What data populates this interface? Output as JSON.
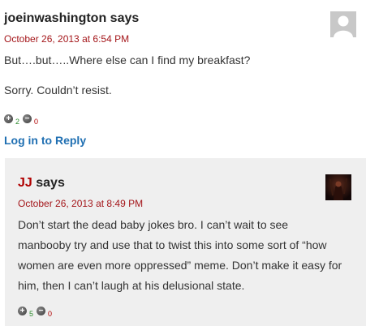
{
  "comment1": {
    "author": "joeinwashington",
    "says": "says",
    "date": "October 26, 2013 at 6:54 PM",
    "paragraphs": [
      "But….but…..Where else can I find my breakfast?",
      "Sorry. Couldn’t resist."
    ],
    "votes_up": "2",
    "votes_down": "0",
    "reply_link": "Log in to Reply"
  },
  "comment2": {
    "author": "JJ",
    "says": "says",
    "date": "October 26, 2013 at 8:49 PM",
    "lines": [
      "Don’t start the dead baby jokes bro. I can’t wait to see",
      "manbooby try and use that to twist this into some sort of “how",
      "women are even more oppressed” meme. Don’t make it easy for",
      "him, then I can’t laugh at his delusional state."
    ],
    "votes_up": "5",
    "votes_down": "0"
  },
  "icons": {
    "vote_up": "plus-circle-icon",
    "vote_down": "minus-circle-icon"
  },
  "colors": {
    "date": "#a4161a",
    "link": "#1f6fb2",
    "jj_name": "#b00000",
    "up_count": "#2e8b2e",
    "down_count": "#b00000",
    "reply_bg": "#efefef"
  }
}
